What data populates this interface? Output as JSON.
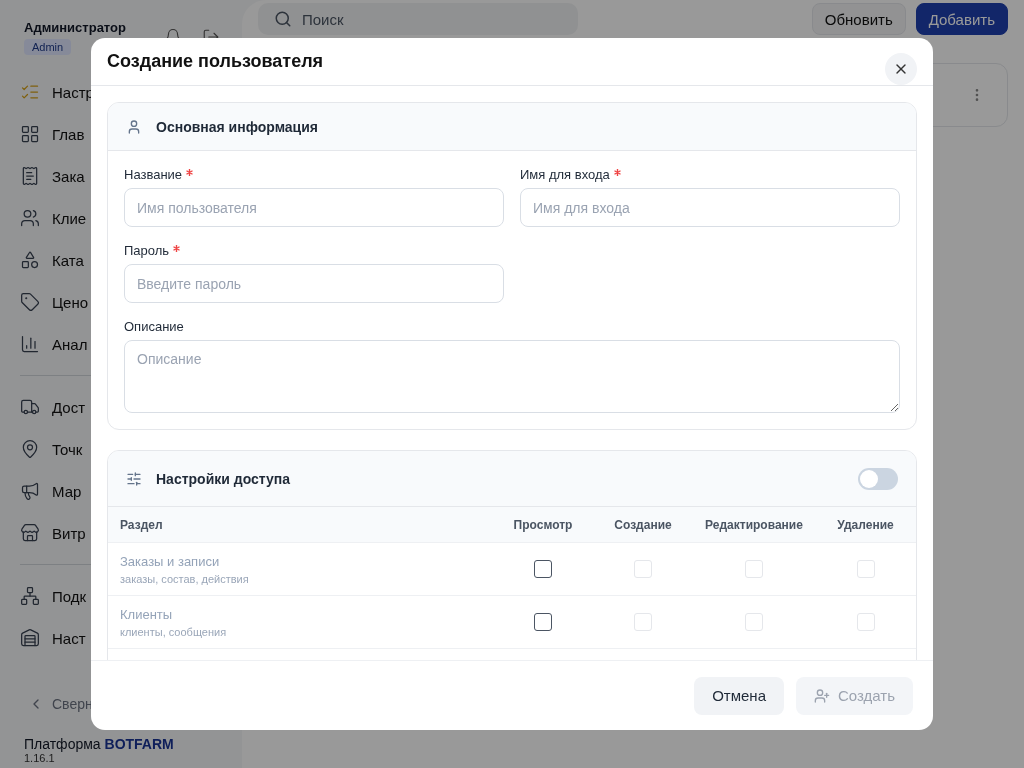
{
  "sidebar": {
    "user_name": "Администратор",
    "role_badge": "Admin",
    "items": [
      {
        "label": "Настр",
        "divider_before": false
      },
      {
        "label": "Глав",
        "divider_before": false
      },
      {
        "label": "Зака",
        "divider_before": false
      },
      {
        "label": "Клие",
        "divider_before": false
      },
      {
        "label": "Ката",
        "divider_before": false
      },
      {
        "label": "Цено",
        "divider_before": false
      },
      {
        "label": "Анал",
        "divider_before": false
      },
      {
        "label": "Дост",
        "divider_before": true
      },
      {
        "label": "Точк",
        "divider_before": false
      },
      {
        "label": "Мар",
        "divider_before": false
      },
      {
        "label": "Витр",
        "divider_before": false
      },
      {
        "label": "Подк",
        "divider_before": true
      },
      {
        "label": "Наст",
        "divider_before": false
      }
    ],
    "collapse": "Сверн",
    "platform": "Платформа **BOTFARM**",
    "version": "1.16.1"
  },
  "toolbar": {
    "search_placeholder": "Поиск",
    "buttons": [
      {
        "label": "Обновить",
        "kind": "secondary"
      },
      {
        "label": "Добавить",
        "kind": "primary"
      }
    ]
  },
  "dialog": {
    "title": "Создание пользователя",
    "basic": {
      "title": "Основная информация",
      "fields": [
        {
          "label": "Название",
          "required": true,
          "placeholder": "Имя пользователя",
          "kind": "input"
        },
        {
          "label": "Имя для входа",
          "required": true,
          "placeholder": "Имя для входа",
          "kind": "input"
        },
        {
          "label": "Пароль",
          "required": true,
          "placeholder": "Введите пароль",
          "kind": "input"
        },
        {
          "label": "Описание",
          "required": false,
          "placeholder": "Описание",
          "kind": "textarea"
        }
      ]
    },
    "access": {
      "title": "Настройки доступа",
      "on": false,
      "columns": [
        "Раздел",
        "Просмотр",
        "Создание",
        "Редактирование",
        "Удаление"
      ],
      "rows": [
        {
          "title": "Заказы и записи",
          "subtitle": "заказы, состав, действия",
          "disabled": true,
          "perms": [
            {
              "checked": false,
              "disabled": false
            },
            {
              "checked": false,
              "disabled": true
            },
            {
              "checked": false,
              "disabled": true
            },
            {
              "checked": false,
              "disabled": true
            }
          ]
        },
        {
          "title": "Клиенты",
          "subtitle": "клиенты, сообщения",
          "disabled": true,
          "perms": [
            {
              "checked": false,
              "disabled": false
            },
            {
              "checked": false,
              "disabled": true
            },
            {
              "checked": false,
              "disabled": true
            },
            {
              "checked": false,
              "disabled": true
            }
          ]
        }
      ]
    },
    "buttons": [
      {
        "label": "Отмена",
        "kind": "cancel",
        "disabled": false
      },
      {
        "label": "Создать",
        "kind": "create",
        "disabled": true
      }
    ]
  }
}
